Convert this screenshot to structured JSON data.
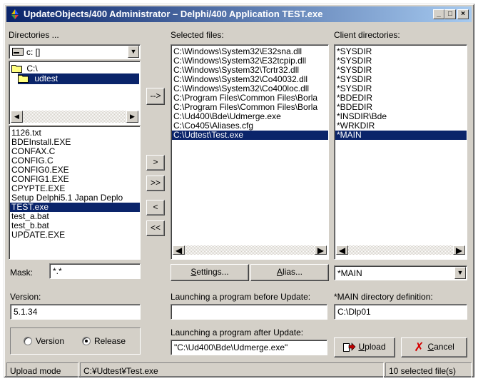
{
  "window": {
    "title": "UpdateObjects/400 Administrator – Delphi/400 Application TEST.exe",
    "min": "_",
    "max": "□",
    "close": "×"
  },
  "directories": {
    "label": "Directories ...",
    "drive": "c: []",
    "tree": [
      "C:\\",
      "udtest"
    ],
    "files": [
      "1126.txt",
      "BDEInstall.EXE",
      "CONFAX.C",
      "CONFIG.C",
      "CONFIG0.EXE",
      "CONFIG1.EXE",
      "CPYPTE.EXE",
      "Setup Delphi5.1 Japan Deplo",
      "TEST.exe",
      "test_a.bat",
      "test_b.bat",
      "UPDATE.EXE"
    ],
    "selected_file": "TEST.exe"
  },
  "mask": {
    "label": "Mask:",
    "value": "*.*"
  },
  "transfer_buttons": {
    "dir_add": "-->",
    "add": ">",
    "add_all": ">>",
    "remove": "<",
    "remove_all": "<<"
  },
  "selected_files": {
    "label": "Selected files:",
    "items": [
      "C:\\Windows\\System32\\E32sna.dll",
      "C:\\Windows\\System32\\E32tcpip.dll",
      "C:\\Windows\\System32\\Tcrtr32.dll",
      "C:\\Windows\\System32\\Co40032.dll",
      "C:\\Windows\\System32\\Co400loc.dll",
      "C:\\Program Files\\Common Files\\Borla",
      "C:\\Program Files\\Common Files\\Borla",
      "C:\\Ud400\\Bde\\Udmerge.exe",
      "C:\\Co405\\Aliases.cfg",
      "C:\\Udtest\\Test.exe"
    ],
    "selected": "C:\\Udtest\\Test.exe"
  },
  "client_directories": {
    "label": "Client directories:",
    "items": [
      "*SYSDIR",
      "*SYSDIR",
      "*SYSDIR",
      "*SYSDIR",
      "*SYSDIR",
      "*BDEDIR",
      "*BDEDIR",
      "*INSDIR\\Bde",
      "*WRKDIR",
      "*MAIN"
    ],
    "selected": "*MAIN",
    "combo_value": "*MAIN"
  },
  "buttons": {
    "settings_pre": "",
    "settings_u": "S",
    "settings_post": "ettings...",
    "alias_pre": "",
    "alias_u": "A",
    "alias_post": "lias...",
    "upload_u": "U",
    "upload_post": "pload",
    "cancel_u": "C",
    "cancel_post": "ancel"
  },
  "version": {
    "label": "Version:",
    "value": "5.1.34"
  },
  "mode": {
    "version_label": "Version",
    "release_label": "Release",
    "selected": "Release"
  },
  "before_update": {
    "label": "Launching a program before Update:",
    "value": ""
  },
  "after_update": {
    "label": "Launching a program after Update:",
    "value": "\"C:\\Ud400\\Bde\\Udmerge.exe\""
  },
  "main_dir": {
    "label": "*MAIN directory definition:",
    "value": "C:\\Dlp01"
  },
  "statusbar": {
    "mode": "Upload mode",
    "path": "C:¥Udtest¥Test.exe",
    "count": "10 selected file(s)"
  },
  "colors": {
    "selection": "#0a246a",
    "face": "#d4d0c8",
    "title_start": "#0a246a",
    "title_end": "#a6caf0",
    "cancel_x": "#d40000"
  }
}
